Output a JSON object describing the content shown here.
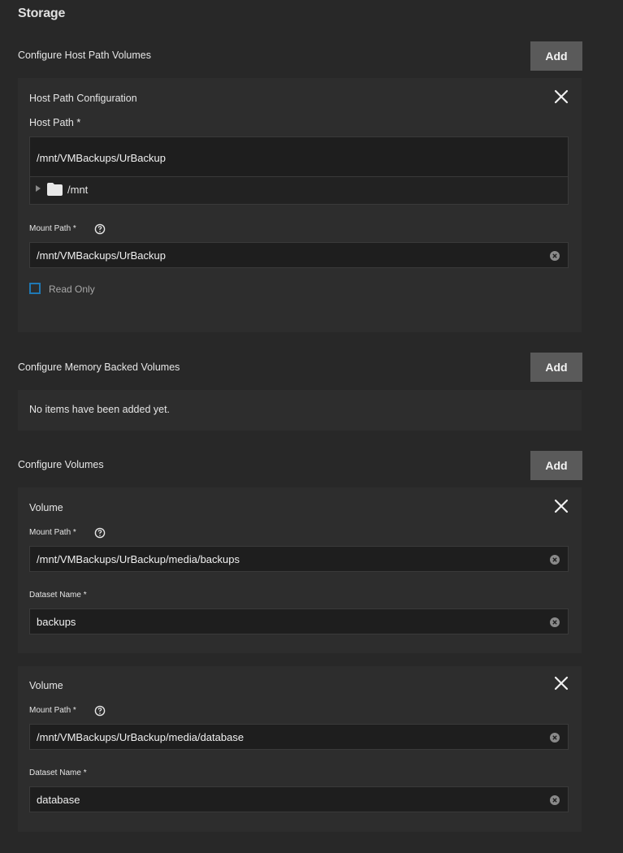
{
  "storage": {
    "title": "Storage",
    "add_label": "Add",
    "host_path": {
      "group_label": "Configure Host Path Volumes",
      "card_title": "Host Path Configuration",
      "host_path_label": "Host Path *",
      "host_path_value": "/mnt/VMBackups/UrBackup",
      "tree_item": "/mnt",
      "mount_path_label": "Mount Path *",
      "mount_path_value": "/mnt/VMBackups/UrBackup",
      "read_only_label": "Read Only"
    },
    "memory": {
      "group_label": "Configure Memory Backed Volumes",
      "empty_text": "No items have been added yet."
    },
    "volumes": {
      "group_label": "Configure Volumes",
      "items": [
        {
          "title": "Volume",
          "mount_path_label": "Mount Path *",
          "mount_path_value": "/mnt/VMBackups/UrBackup/media/backups",
          "dataset_label": "Dataset Name *",
          "dataset_value": "backups"
        },
        {
          "title": "Volume",
          "mount_path_label": "Mount Path *",
          "mount_path_value": "/mnt/VMBackups/UrBackup/media/database",
          "dataset_label": "Dataset Name *",
          "dataset_value": "database"
        }
      ]
    }
  },
  "icons": {
    "close": "close-icon",
    "help": "help-circle-icon",
    "clear": "clear-circle-icon",
    "folder": "folder-icon",
    "expand": "caret-right-icon"
  },
  "colors": {
    "background": "#282828",
    "card": "#2d2d2d",
    "button": "#5a5a5a",
    "checkbox_border": "#1f78b4"
  }
}
